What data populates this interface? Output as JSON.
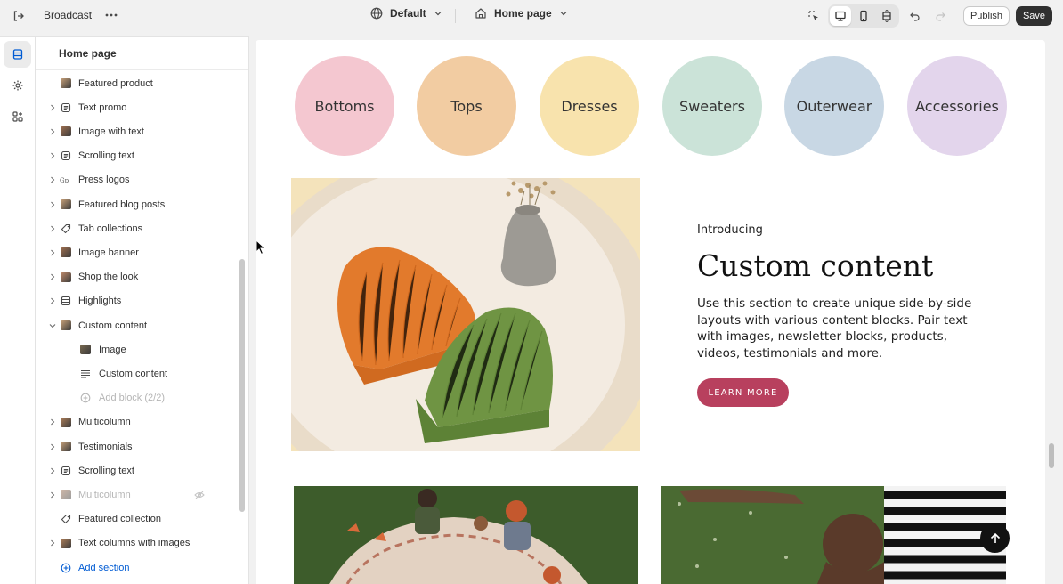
{
  "topbar": {
    "store_name": "Broadcast",
    "theme_label": "Default",
    "page_label": "Home page",
    "publish_label": "Publish",
    "save_label": "Save"
  },
  "sidebar": {
    "title": "Home page",
    "items": [
      {
        "label": "Featured product",
        "icon": "image-thumbnail",
        "chevron": false
      },
      {
        "label": "Text promo",
        "icon": "text-block-icon",
        "chevron": true
      },
      {
        "label": "Image with text",
        "icon": "image-thumbnail",
        "chevron": true
      },
      {
        "label": "Scrolling text",
        "icon": "text-block-icon",
        "chevron": true
      },
      {
        "label": "Press logos",
        "icon": "logo-thumbnail",
        "chevron": true
      },
      {
        "label": "Featured blog posts",
        "icon": "image-thumbnail",
        "chevron": true
      },
      {
        "label": "Tab collections",
        "icon": "tag-icon",
        "chevron": true
      },
      {
        "label": "Image banner",
        "icon": "image-thumbnail",
        "chevron": true
      },
      {
        "label": "Shop the look",
        "icon": "image-thumbnail",
        "chevron": true
      },
      {
        "label": "Highlights",
        "icon": "list-icon",
        "chevron": true
      },
      {
        "label": "Custom content",
        "icon": "image-thumbnail",
        "chevron": true,
        "expanded": true
      },
      {
        "label": "Image",
        "icon": "image-thumbnail",
        "child": true
      },
      {
        "label": "Custom content",
        "icon": "text-lines-icon",
        "child": true
      },
      {
        "label": "Add block (2/2)",
        "icon": "add-circle-icon",
        "child": true,
        "muted": true
      },
      {
        "label": "Multicolumn",
        "icon": "image-thumbnail",
        "chevron": true
      },
      {
        "label": "Testimonials",
        "icon": "image-thumbnail",
        "chevron": true
      },
      {
        "label": "Scrolling text",
        "icon": "text-block-icon",
        "chevron": true
      },
      {
        "label": "Multicolumn",
        "icon": "image-thumbnail",
        "chevron": true,
        "muted": true,
        "hidden": true
      },
      {
        "label": "Featured collection",
        "icon": "tag-icon",
        "chevron": false
      },
      {
        "label": "Text columns with images",
        "icon": "image-thumbnail",
        "chevron": true
      },
      {
        "label": "Add section",
        "icon": "add-circle-icon",
        "add": true
      }
    ]
  },
  "preview": {
    "categories": [
      {
        "label": "Bottoms",
        "color": "#f4c7d0"
      },
      {
        "label": "Tops",
        "color": "#f2cca2"
      },
      {
        "label": "Dresses",
        "color": "#f8e3ad"
      },
      {
        "label": "Sweaters",
        "color": "#cbe3d8"
      },
      {
        "label": "Outerwear",
        "color": "#c8d7e4"
      },
      {
        "label": "Accessories",
        "color": "#e3d5ec"
      }
    ],
    "custom_content": {
      "intro": "Introducing",
      "heading": "Custom content",
      "body": "Use this section to create unique side-by-side layouts with various content blocks. Pair text with images, newsletter blocks, products, videos, testimonials and more.",
      "button": "LEARN MORE"
    },
    "accent_color": "#b8405e"
  }
}
